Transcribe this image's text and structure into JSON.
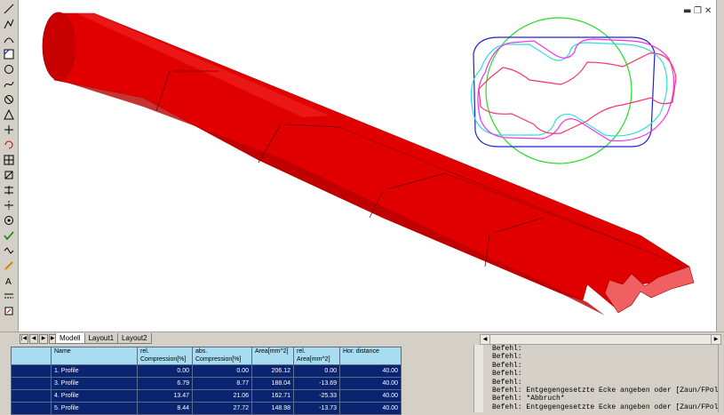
{
  "toolbar": {
    "tools": [
      "line-icon",
      "polyline-icon",
      "arc-icon",
      "hatch-icon",
      "circle-icon",
      "spline-icon",
      "no-icon",
      "triangle-icon",
      "move-icon",
      "rotate-icon",
      "grid-icon",
      "scale-icon",
      "pan-icon",
      "trim-icon",
      "target-icon",
      "check-icon",
      "measure-icon",
      "pencil-icon",
      "text-icon",
      "linetype-icon",
      "edit-icon"
    ]
  },
  "window_controls": {
    "minimize": "▬",
    "restore": "❐",
    "close": "✕"
  },
  "tabs": {
    "items": [
      {
        "label": "Modell",
        "active": true
      },
      {
        "label": "Layout1",
        "active": false
      },
      {
        "label": "Layout2",
        "active": false
      }
    ]
  },
  "table": {
    "headers": {
      "name": "Name",
      "rel_comp": "rel. Compression[%]",
      "abs_comp": "abs. Compression[%]",
      "area": "Area[mm^2]",
      "rel_area": "rel. Area[mm^2]",
      "hor_dist": "Hor. distance"
    },
    "rows": [
      {
        "name": "1. Profile",
        "rel_comp": "0.00",
        "abs_comp": "0.00",
        "area": "206.12",
        "rel_area": "0.00",
        "hor_dist": "40.00"
      },
      {
        "name": "3. Profile",
        "rel_comp": "6.79",
        "abs_comp": "8.77",
        "area": "188.04",
        "rel_area": "-13.69",
        "hor_dist": "40.00"
      },
      {
        "name": "4. Profile",
        "rel_comp": "13.47",
        "abs_comp": "21.06",
        "area": "162.71",
        "rel_area": "-25.33",
        "hor_dist": "40.00"
      },
      {
        "name": "5. Profile",
        "rel_comp": "8.44",
        "abs_comp": "27.72",
        "area": "148.98",
        "rel_area": "-13.73",
        "hor_dist": "40.00"
      }
    ]
  },
  "command_line": {
    "lines": [
      "Befehl:",
      "Befehl:",
      "Befehl:",
      "Befehl:",
      "Befehl:",
      "Befehl: Entgegengesetzte Ecke angeben oder [Zaun/FPolygo",
      "Befehl: *Abbruch*",
      "Befehl: Entgegengesetzte Ecke angeben oder [Zaun/FPolygo"
    ]
  },
  "colors": {
    "solid": "#e00000",
    "profile_red": "#ff3366",
    "profile_magenta": "#ee33ee",
    "profile_cyan": "#33dddd",
    "profile_blue": "#2020d0",
    "profile_green": "#22dd22",
    "table_cell": "#0a2470",
    "table_header": "#a8dcf0"
  }
}
